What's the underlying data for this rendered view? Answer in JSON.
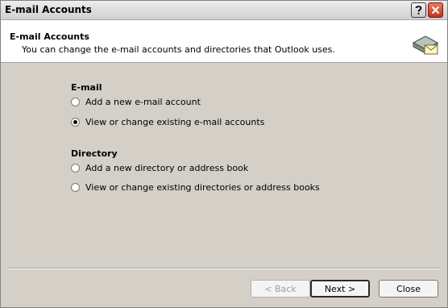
{
  "window": {
    "title": "E-mail Accounts"
  },
  "header": {
    "title": "E-mail Accounts",
    "subtitle": "You can change the e-mail accounts and directories that Outlook uses."
  },
  "email_group": {
    "title": "E-mail",
    "options": [
      {
        "label": "Add a new e-mail account",
        "selected": false
      },
      {
        "label": "View or change existing e-mail accounts",
        "selected": true
      }
    ]
  },
  "directory_group": {
    "title": "Directory",
    "options": [
      {
        "label": "Add a new directory or address book",
        "selected": false
      },
      {
        "label": "View or change existing directories or address books",
        "selected": false
      }
    ]
  },
  "buttons": {
    "back": "< Back",
    "next": "Next >",
    "close": "Close"
  },
  "colors": {
    "dialog_bg": "#d4d0c8",
    "close_button": "#c2341a"
  }
}
